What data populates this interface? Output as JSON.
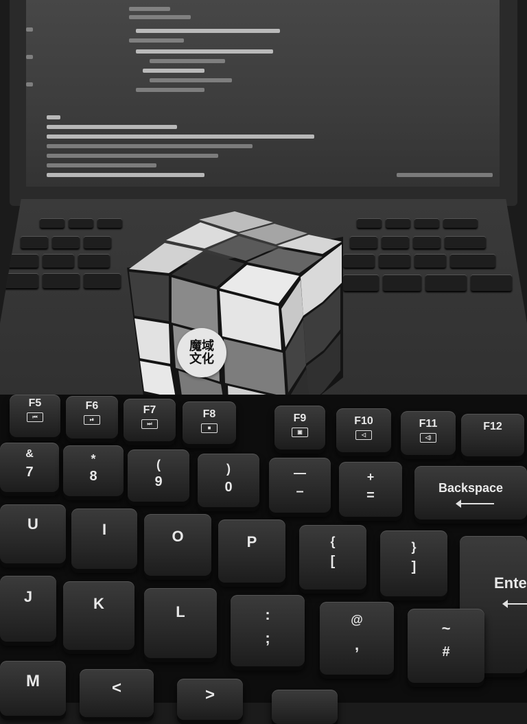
{
  "cube": {
    "logo_line1": "魔域",
    "logo_line2": "文化"
  },
  "keyboard": {
    "function_row": [
      {
        "label": "F5",
        "icon": "⏮"
      },
      {
        "label": "F6",
        "icon": "⏯"
      },
      {
        "label": "F7",
        "icon": "⏭"
      },
      {
        "label": "F8",
        "icon": "■"
      },
      {
        "label": "F9",
        "icon": "▣"
      },
      {
        "label": "F10",
        "icon": "◁"
      },
      {
        "label": "F11",
        "icon": "◁)"
      },
      {
        "label": "F12",
        "icon": ""
      }
    ],
    "number_row": [
      {
        "top": "&",
        "bottom": "7"
      },
      {
        "top": "*",
        "bottom": "8"
      },
      {
        "top": "(",
        "bottom": "9"
      },
      {
        "top": ")",
        "bottom": "0"
      },
      {
        "top": "—",
        "bottom": "–"
      },
      {
        "top": "+",
        "bottom": "="
      }
    ],
    "backspace_label": "Backspace",
    "upper_row": [
      {
        "top": "U",
        "bottom": ""
      },
      {
        "top": "I",
        "bottom": ""
      },
      {
        "top": "O",
        "bottom": ""
      },
      {
        "top": "P",
        "bottom": ""
      },
      {
        "top": "{",
        "bottom": "["
      },
      {
        "top": "}",
        "bottom": "]"
      }
    ],
    "enter_label": "Ente",
    "home_row": [
      {
        "top": "J",
        "bottom": ""
      },
      {
        "top": "K",
        "bottom": ""
      },
      {
        "top": "L",
        "bottom": ""
      },
      {
        "top": ":",
        "bottom": ";"
      },
      {
        "top": "@",
        "bottom": ","
      },
      {
        "top": "~",
        "bottom": "#"
      }
    ],
    "bottom_row": [
      {
        "top": "M",
        "bottom": ""
      },
      {
        "top": "<",
        "bottom": ""
      },
      {
        "top": ">",
        "bottom": ""
      }
    ]
  }
}
